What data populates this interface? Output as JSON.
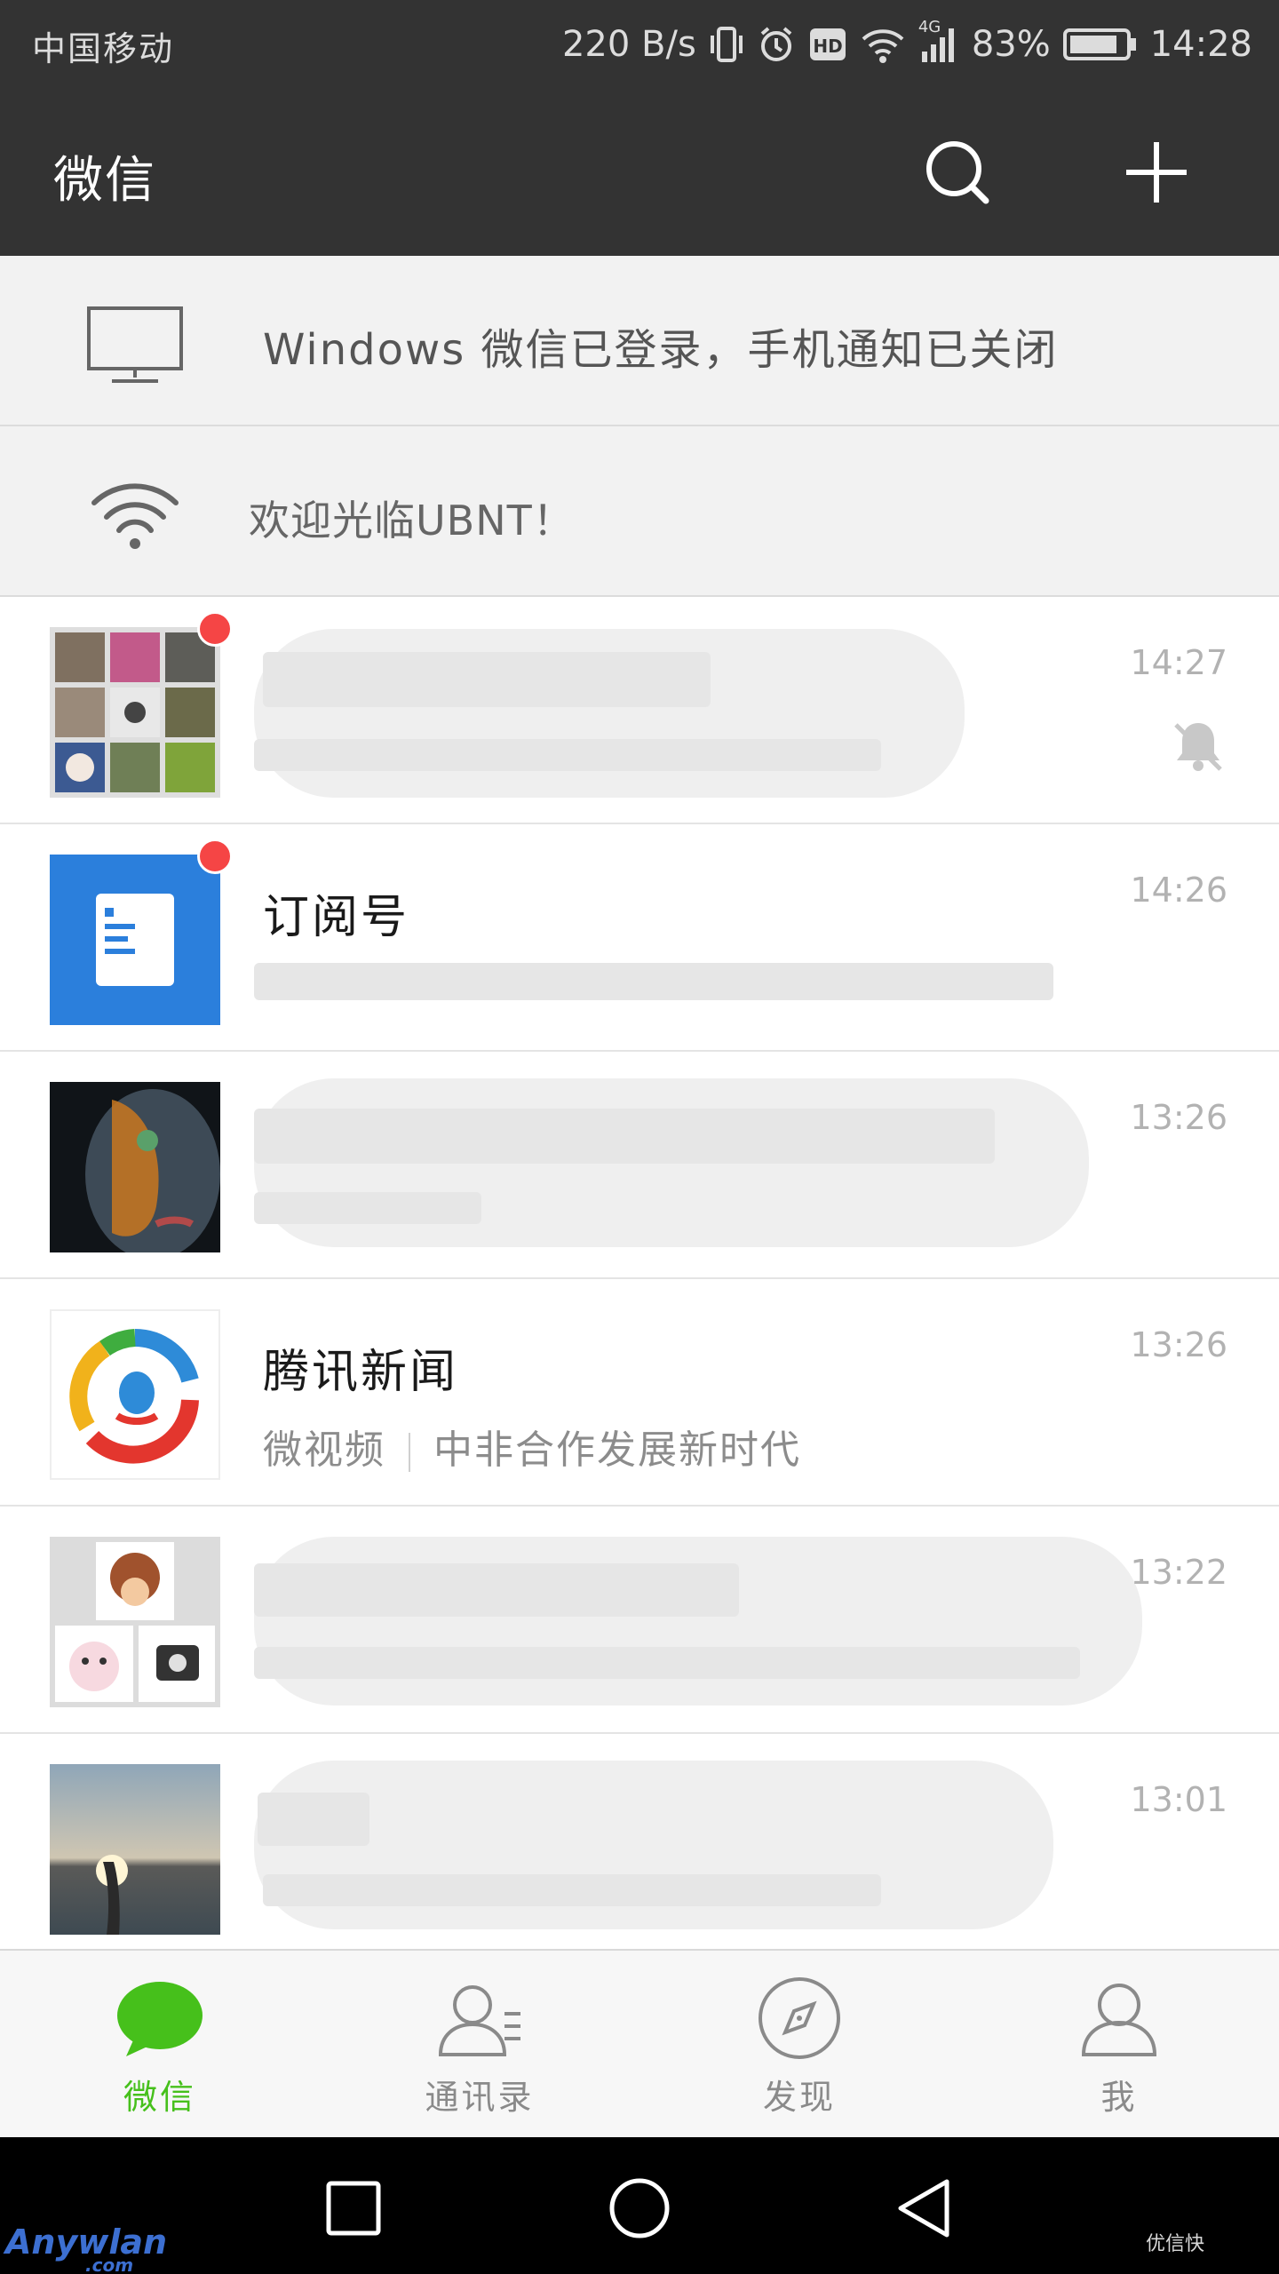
{
  "status_bar": {
    "carrier": "中国移动",
    "net_speed": "220 B/s",
    "network_type": "4G",
    "battery": "83%",
    "time": "14:28"
  },
  "top_bar": {
    "title": "微信"
  },
  "banners": {
    "pc_login": "Windows 微信已登录，手机通知已关闭",
    "wifi": "欢迎光临UBNT！"
  },
  "chats": [
    {
      "name": "",
      "preview": "",
      "time": "14:27",
      "unread": true,
      "muted": true
    },
    {
      "name": "订阅号",
      "preview": "",
      "time": "14:26",
      "unread": true,
      "muted": false
    },
    {
      "name": "",
      "preview": "",
      "time": "13:26",
      "unread": false,
      "muted": false
    },
    {
      "name": "腾讯新闻",
      "preview_tag": "微视频",
      "preview": "中非合作发展新时代",
      "time": "13:26",
      "unread": false,
      "muted": false
    },
    {
      "name": "",
      "preview": "",
      "time": "13:22",
      "unread": false,
      "muted": false
    },
    {
      "name": "",
      "preview": "",
      "time": "13:01",
      "unread": false,
      "muted": false
    }
  ],
  "tabs": [
    {
      "label": "微信",
      "icon": "chat-bubble-icon",
      "active": true
    },
    {
      "label": "通讯录",
      "icon": "contacts-icon",
      "active": false
    },
    {
      "label": "发现",
      "icon": "compass-icon",
      "active": false
    },
    {
      "label": "我",
      "icon": "person-icon",
      "active": false
    }
  ],
  "colors": {
    "header_bg": "#333333",
    "accent_green": "#46c01b",
    "unread_red": "#f54545",
    "subscription_blue": "#2b7fdc"
  },
  "watermarks": {
    "left": "Anywlan",
    "left_sub": ".com",
    "right": "优信快"
  }
}
